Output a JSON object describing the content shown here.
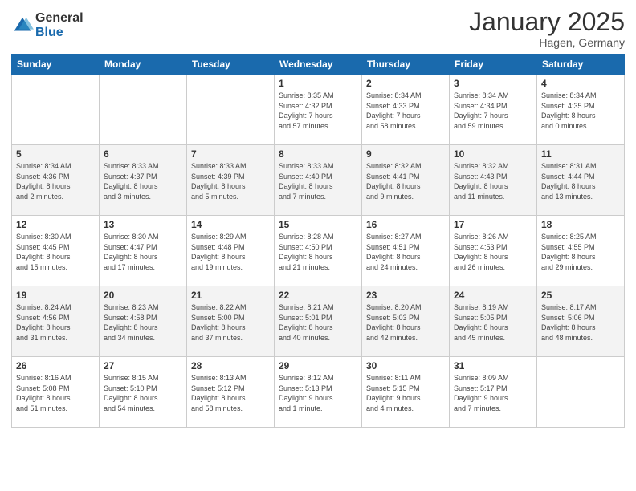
{
  "logo": {
    "general": "General",
    "blue": "Blue"
  },
  "title": "January 2025",
  "location": "Hagen, Germany",
  "days_of_week": [
    "Sunday",
    "Monday",
    "Tuesday",
    "Wednesday",
    "Thursday",
    "Friday",
    "Saturday"
  ],
  "weeks": [
    [
      {
        "day": "",
        "info": ""
      },
      {
        "day": "",
        "info": ""
      },
      {
        "day": "",
        "info": ""
      },
      {
        "day": "1",
        "info": "Sunrise: 8:35 AM\nSunset: 4:32 PM\nDaylight: 7 hours\nand 57 minutes."
      },
      {
        "day": "2",
        "info": "Sunrise: 8:34 AM\nSunset: 4:33 PM\nDaylight: 7 hours\nand 58 minutes."
      },
      {
        "day": "3",
        "info": "Sunrise: 8:34 AM\nSunset: 4:34 PM\nDaylight: 7 hours\nand 59 minutes."
      },
      {
        "day": "4",
        "info": "Sunrise: 8:34 AM\nSunset: 4:35 PM\nDaylight: 8 hours\nand 0 minutes."
      }
    ],
    [
      {
        "day": "5",
        "info": "Sunrise: 8:34 AM\nSunset: 4:36 PM\nDaylight: 8 hours\nand 2 minutes."
      },
      {
        "day": "6",
        "info": "Sunrise: 8:33 AM\nSunset: 4:37 PM\nDaylight: 8 hours\nand 3 minutes."
      },
      {
        "day": "7",
        "info": "Sunrise: 8:33 AM\nSunset: 4:39 PM\nDaylight: 8 hours\nand 5 minutes."
      },
      {
        "day": "8",
        "info": "Sunrise: 8:33 AM\nSunset: 4:40 PM\nDaylight: 8 hours\nand 7 minutes."
      },
      {
        "day": "9",
        "info": "Sunrise: 8:32 AM\nSunset: 4:41 PM\nDaylight: 8 hours\nand 9 minutes."
      },
      {
        "day": "10",
        "info": "Sunrise: 8:32 AM\nSunset: 4:43 PM\nDaylight: 8 hours\nand 11 minutes."
      },
      {
        "day": "11",
        "info": "Sunrise: 8:31 AM\nSunset: 4:44 PM\nDaylight: 8 hours\nand 13 minutes."
      }
    ],
    [
      {
        "day": "12",
        "info": "Sunrise: 8:30 AM\nSunset: 4:45 PM\nDaylight: 8 hours\nand 15 minutes."
      },
      {
        "day": "13",
        "info": "Sunrise: 8:30 AM\nSunset: 4:47 PM\nDaylight: 8 hours\nand 17 minutes."
      },
      {
        "day": "14",
        "info": "Sunrise: 8:29 AM\nSunset: 4:48 PM\nDaylight: 8 hours\nand 19 minutes."
      },
      {
        "day": "15",
        "info": "Sunrise: 8:28 AM\nSunset: 4:50 PM\nDaylight: 8 hours\nand 21 minutes."
      },
      {
        "day": "16",
        "info": "Sunrise: 8:27 AM\nSunset: 4:51 PM\nDaylight: 8 hours\nand 24 minutes."
      },
      {
        "day": "17",
        "info": "Sunrise: 8:26 AM\nSunset: 4:53 PM\nDaylight: 8 hours\nand 26 minutes."
      },
      {
        "day": "18",
        "info": "Sunrise: 8:25 AM\nSunset: 4:55 PM\nDaylight: 8 hours\nand 29 minutes."
      }
    ],
    [
      {
        "day": "19",
        "info": "Sunrise: 8:24 AM\nSunset: 4:56 PM\nDaylight: 8 hours\nand 31 minutes."
      },
      {
        "day": "20",
        "info": "Sunrise: 8:23 AM\nSunset: 4:58 PM\nDaylight: 8 hours\nand 34 minutes."
      },
      {
        "day": "21",
        "info": "Sunrise: 8:22 AM\nSunset: 5:00 PM\nDaylight: 8 hours\nand 37 minutes."
      },
      {
        "day": "22",
        "info": "Sunrise: 8:21 AM\nSunset: 5:01 PM\nDaylight: 8 hours\nand 40 minutes."
      },
      {
        "day": "23",
        "info": "Sunrise: 8:20 AM\nSunset: 5:03 PM\nDaylight: 8 hours\nand 42 minutes."
      },
      {
        "day": "24",
        "info": "Sunrise: 8:19 AM\nSunset: 5:05 PM\nDaylight: 8 hours\nand 45 minutes."
      },
      {
        "day": "25",
        "info": "Sunrise: 8:17 AM\nSunset: 5:06 PM\nDaylight: 8 hours\nand 48 minutes."
      }
    ],
    [
      {
        "day": "26",
        "info": "Sunrise: 8:16 AM\nSunset: 5:08 PM\nDaylight: 8 hours\nand 51 minutes."
      },
      {
        "day": "27",
        "info": "Sunrise: 8:15 AM\nSunset: 5:10 PM\nDaylight: 8 hours\nand 54 minutes."
      },
      {
        "day": "28",
        "info": "Sunrise: 8:13 AM\nSunset: 5:12 PM\nDaylight: 8 hours\nand 58 minutes."
      },
      {
        "day": "29",
        "info": "Sunrise: 8:12 AM\nSunset: 5:13 PM\nDaylight: 9 hours\nand 1 minute."
      },
      {
        "day": "30",
        "info": "Sunrise: 8:11 AM\nSunset: 5:15 PM\nDaylight: 9 hours\nand 4 minutes."
      },
      {
        "day": "31",
        "info": "Sunrise: 8:09 AM\nSunset: 5:17 PM\nDaylight: 9 hours\nand 7 minutes."
      },
      {
        "day": "",
        "info": ""
      }
    ]
  ]
}
